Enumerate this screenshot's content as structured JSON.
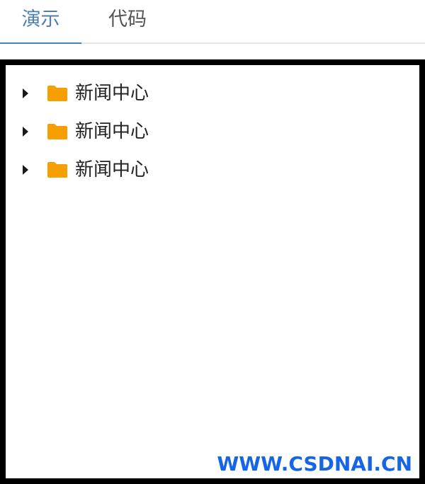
{
  "tabs": {
    "demo_label": "演示",
    "code_label": "代码",
    "active": "演示",
    "active_color": "#4d7fb0"
  },
  "tree": {
    "nodes": [
      {
        "label": "新闻中心",
        "icon": "folder-icon",
        "expanded": false
      },
      {
        "label": "新闻中心",
        "icon": "folder-icon",
        "expanded": false
      },
      {
        "label": "新闻中心",
        "icon": "folder-icon",
        "expanded": false
      }
    ],
    "folder_color": "#f5a000"
  },
  "watermark": {
    "text": "WWW.CSDNAI.CN",
    "color": "#1565e6"
  }
}
